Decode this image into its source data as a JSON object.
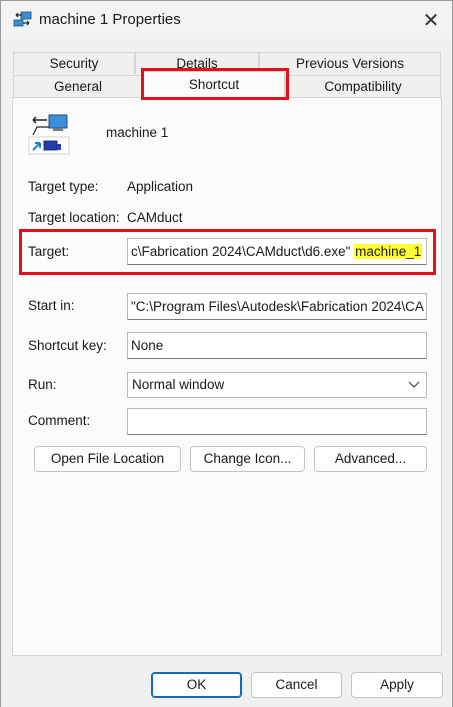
{
  "window": {
    "title": "machine 1 Properties",
    "close_glyph": "✕"
  },
  "tabs": {
    "row1": [
      "Security",
      "Details",
      "Previous Versions"
    ],
    "row2": [
      "General",
      "Shortcut",
      "Compatibility"
    ],
    "active": "Shortcut"
  },
  "shortcut": {
    "name": "machine 1",
    "target_type_label": "Target type:",
    "target_type_value": "Application",
    "target_location_label": "Target location:",
    "target_location_value": "CAMduct",
    "target_label": "Target:",
    "target_value_main": "c\\Fabrication 2024\\CAMduct\\d6.exe\" ",
    "target_value_highlight": "machine_1",
    "start_in_label": "Start in:",
    "start_in_value": "\"C:\\Program Files\\Autodesk\\Fabrication 2024\\CA",
    "shortcut_key_label": "Shortcut key:",
    "shortcut_key_value": "None",
    "run_label": "Run:",
    "run_value": "Normal window",
    "comment_label": "Comment:",
    "comment_value": ""
  },
  "buttons": {
    "open_file_location": "Open File Location",
    "change_icon": "Change Icon...",
    "advanced": "Advanced...",
    "ok": "OK",
    "cancel": "Cancel",
    "apply": "Apply"
  },
  "colors": {
    "annotation_red": "#e3101b",
    "highlight_yellow": "#ffff33",
    "primary_blue": "#0f6cbd"
  }
}
